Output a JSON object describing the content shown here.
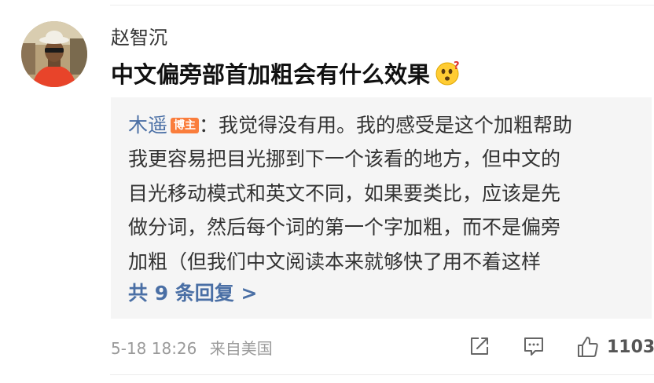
{
  "comment": {
    "username": "赵智沉",
    "text": "中文偏旁部首加粗会有什么效果",
    "emoji_icon": "thinking-face-icon",
    "reply": {
      "author": "木遥",
      "author_badge": "博主",
      "lines": [
        "：我觉得没有用。我的感受是这个加粗帮助",
        "我更容易把目光挪到下一个该看的地方，但中文的",
        "目光移动模式和英文不同，如果要类比，应该是先",
        "做分词，然后每个词的第一个字加粗，而不是偏旁",
        "加粗（但我们中文阅读本来就够快了用不着这样"
      ],
      "view_replies_label": "共 9 条回复 >"
    },
    "meta": {
      "date": "5-18 18:26",
      "location": "来自美国"
    },
    "actions": {
      "share_icon": "share-icon",
      "comment_icon": "comment-icon",
      "like_icon": "thumbs-up-icon",
      "like_count": "1103"
    }
  },
  "colors": {
    "link_blue": "#4a6fa5",
    "badge_orange": "#fa7d3c",
    "reply_bg": "#f5f5f5",
    "meta_gray": "#9a9a9a"
  }
}
